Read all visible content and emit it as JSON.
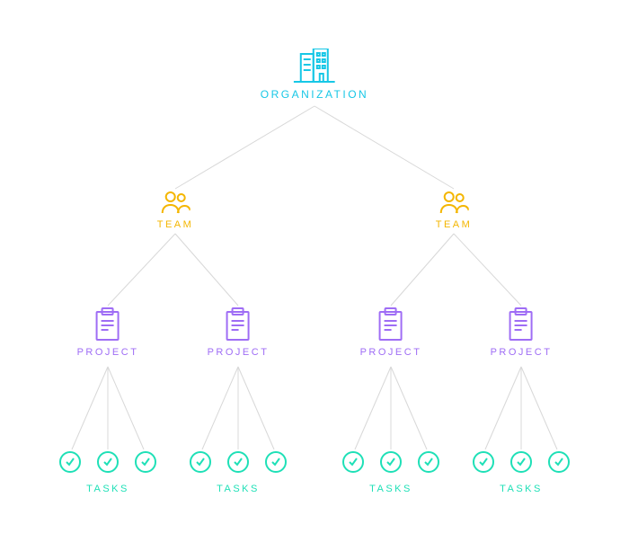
{
  "org": {
    "label": "ORGANIZATION"
  },
  "teams": [
    {
      "label": "TEAM"
    },
    {
      "label": "TEAM"
    }
  ],
  "projects": [
    {
      "label": "PROJECT"
    },
    {
      "label": "PROJECT"
    },
    {
      "label": "PROJECT"
    },
    {
      "label": "PROJECT"
    }
  ],
  "tasks": [
    {
      "label": "TASKS"
    },
    {
      "label": "TASKS"
    },
    {
      "label": "TASKS"
    },
    {
      "label": "TASKS"
    }
  ],
  "colors": {
    "org": "#17c7e6",
    "team": "#f4b600",
    "project": "#9f6df5",
    "task": "#1fe0b7",
    "line": "#d8d8d8"
  }
}
